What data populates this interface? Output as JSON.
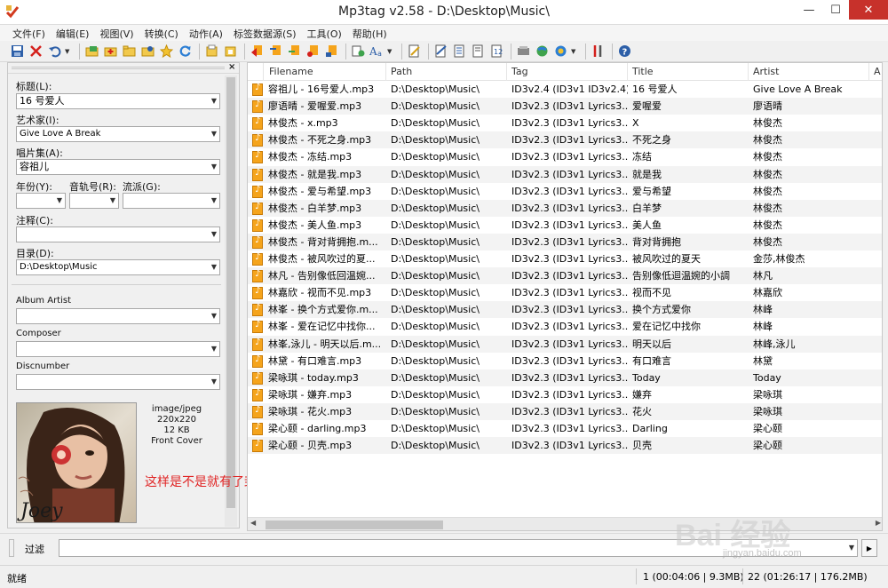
{
  "window": {
    "title": "Mp3tag v2.58  -  D:\\Desktop\\Music\\",
    "minimize": "—",
    "maximize": "☐",
    "close": "✕"
  },
  "menu": [
    "文件(F)",
    "编辑(E)",
    "视图(V)",
    "转换(C)",
    "动作(A)",
    "标签数据源(S)",
    "工具(O)",
    "帮助(H)"
  ],
  "toolbar": {
    "icons": [
      "save-icon",
      "remove-icon",
      "undo-icon",
      "add-directory-icon",
      "change-directory-icon",
      "favorite-icon",
      "refresh-icon",
      "tag-sources-icon",
      "convert-icon",
      "actions-icon",
      "autonumber-icon",
      "case-icon",
      "export-icon",
      "playlist-icon",
      "options-icon",
      "help-icon"
    ]
  },
  "panel": {
    "close": "×",
    "fields": {
      "title_label": "标题(L):",
      "title_value": "16 号爱人",
      "artist_label": "艺术家(I):",
      "artist_value": "Give Love A Break",
      "album_label": "唱片集(A):",
      "album_value": "容祖儿",
      "year_label": "年份(Y):",
      "year_value": "",
      "track_label": "音轨号(R):",
      "track_value": "",
      "genre_label": "流派(G):",
      "genre_value": "",
      "comment_label": "注释(C):",
      "comment_value": "",
      "directory_label": "目录(D):",
      "directory_value": "D:\\Desktop\\Music",
      "album_artist_label": "Album Artist",
      "album_artist_value": "",
      "composer_label": "Composer",
      "composer_value": "",
      "discnumber_label": "Discnumber",
      "discnumber_value": ""
    },
    "cover": {
      "mime": "image/jpeg",
      "dimensions": "220x220",
      "size": "12 KB",
      "type": "Front Cover",
      "caption": "Joey"
    }
  },
  "annotation": "这样是不是就有了封面了，接下来处理下一个音乐。先别动其他的，封面先弄完再说",
  "filelist": {
    "columns": [
      "Filename",
      "Path",
      "Tag",
      "Title",
      "Artist",
      "A"
    ],
    "rows": [
      {
        "filename": "容祖儿 - 16号爱人.mp3",
        "path": "D:\\Desktop\\Music\\",
        "tag": "ID3v2.4 (ID3v1 ID3v2.4)",
        "title": "16 号爱人",
        "artist": "Give Love A Break"
      },
      {
        "filename": "廖语晴 - 爱喔爱.mp3",
        "path": "D:\\Desktop\\Music\\",
        "tag": "ID3v2.3 (ID3v1 Lyrics3...",
        "title": "爱喔爱",
        "artist": "廖语晴"
      },
      {
        "filename": "林俊杰 - x.mp3",
        "path": "D:\\Desktop\\Music\\",
        "tag": "ID3v2.3 (ID3v1 Lyrics3...",
        "title": "X",
        "artist": "林俊杰"
      },
      {
        "filename": "林俊杰 - 不死之身.mp3",
        "path": "D:\\Desktop\\Music\\",
        "tag": "ID3v2.3 (ID3v1 Lyrics3...",
        "title": "不死之身",
        "artist": "林俊杰"
      },
      {
        "filename": "林俊杰 - 冻结.mp3",
        "path": "D:\\Desktop\\Music\\",
        "tag": "ID3v2.3 (ID3v1 Lyrics3...",
        "title": "冻结",
        "artist": "林俊杰"
      },
      {
        "filename": "林俊杰 - 就是我.mp3",
        "path": "D:\\Desktop\\Music\\",
        "tag": "ID3v2.3 (ID3v1 Lyrics3...",
        "title": "就是我",
        "artist": "林俊杰"
      },
      {
        "filename": "林俊杰 - 爱与希望.mp3",
        "path": "D:\\Desktop\\Music\\",
        "tag": "ID3v2.3 (ID3v1 Lyrics3...",
        "title": "爱与希望",
        "artist": "林俊杰"
      },
      {
        "filename": "林俊杰 - 白羊梦.mp3",
        "path": "D:\\Desktop\\Music\\",
        "tag": "ID3v2.3 (ID3v1 Lyrics3...",
        "title": "白羊梦",
        "artist": "林俊杰"
      },
      {
        "filename": "林俊杰 - 美人鱼.mp3",
        "path": "D:\\Desktop\\Music\\",
        "tag": "ID3v2.3 (ID3v1 Lyrics3...",
        "title": "美人鱼",
        "artist": "林俊杰"
      },
      {
        "filename": "林俊杰 - 背对背拥抱.m...",
        "path": "D:\\Desktop\\Music\\",
        "tag": "ID3v2.3 (ID3v1 Lyrics3...",
        "title": "背对背拥抱",
        "artist": "林俊杰"
      },
      {
        "filename": "林俊杰 - 被风吹过的夏...",
        "path": "D:\\Desktop\\Music\\",
        "tag": "ID3v2.3 (ID3v1 Lyrics3...",
        "title": "被风吹过的夏天",
        "artist": "金莎,林俊杰"
      },
      {
        "filename": "林凡 - 告别像低回温婉...",
        "path": "D:\\Desktop\\Music\\",
        "tag": "ID3v2.3 (ID3v1 Lyrics3...",
        "title": "告别像低迴温婉的小調",
        "artist": "林凡"
      },
      {
        "filename": "林嘉欣 - 视而不见.mp3",
        "path": "D:\\Desktop\\Music\\",
        "tag": "ID3v2.3 (ID3v1 Lyrics3...",
        "title": "视而不见",
        "artist": "林嘉欣"
      },
      {
        "filename": "林峯 - 换个方式爱你.m...",
        "path": "D:\\Desktop\\Music\\",
        "tag": "ID3v2.3 (ID3v1 Lyrics3...",
        "title": "换个方式爱你",
        "artist": "林峰"
      },
      {
        "filename": "林峯 - 爱在记忆中找你...",
        "path": "D:\\Desktop\\Music\\",
        "tag": "ID3v2.3 (ID3v1 Lyrics3...",
        "title": "爱在记忆中找你",
        "artist": "林峰"
      },
      {
        "filename": "林峯,泳儿 - 明天以后.m...",
        "path": "D:\\Desktop\\Music\\",
        "tag": "ID3v2.3 (ID3v1 Lyrics3...",
        "title": "明天以后",
        "artist": "林峰,泳儿"
      },
      {
        "filename": "林黛 - 有口难言.mp3",
        "path": "D:\\Desktop\\Music\\",
        "tag": "ID3v2.3 (ID3v1 Lyrics3...",
        "title": "有口难言",
        "artist": "林黛"
      },
      {
        "filename": "梁咏琪 - today.mp3",
        "path": "D:\\Desktop\\Music\\",
        "tag": "ID3v2.3 (ID3v1 Lyrics3...",
        "title": "Today",
        "artist": "Today"
      },
      {
        "filename": "梁咏琪 - 嫌弃.mp3",
        "path": "D:\\Desktop\\Music\\",
        "tag": "ID3v2.3 (ID3v1 Lyrics3...",
        "title": "嫌弃",
        "artist": "梁咏琪"
      },
      {
        "filename": "梁咏琪 - 花火.mp3",
        "path": "D:\\Desktop\\Music\\",
        "tag": "ID3v2.3 (ID3v1 Lyrics3...",
        "title": "花火",
        "artist": "梁咏琪"
      },
      {
        "filename": "梁心颐 - darling.mp3",
        "path": "D:\\Desktop\\Music\\",
        "tag": "ID3v2.3 (ID3v1 Lyrics3...",
        "title": "Darling",
        "artist": "梁心颐"
      },
      {
        "filename": "梁心颐 - 贝壳.mp3",
        "path": "D:\\Desktop\\Music\\",
        "tag": "ID3v2.3 (ID3v1 Lyrics3...",
        "title": "贝壳",
        "artist": "梁心颐"
      }
    ]
  },
  "filter": {
    "label": "过滤",
    "value": ""
  },
  "status": {
    "ready": "就绪",
    "selected": "1 (00:04:06 | 9.3MB)",
    "total": "22 (01:26:17 | 176.2MB)"
  },
  "watermark": {
    "brand": "Bai 经验",
    "url": "jingyan.baidu.com"
  }
}
